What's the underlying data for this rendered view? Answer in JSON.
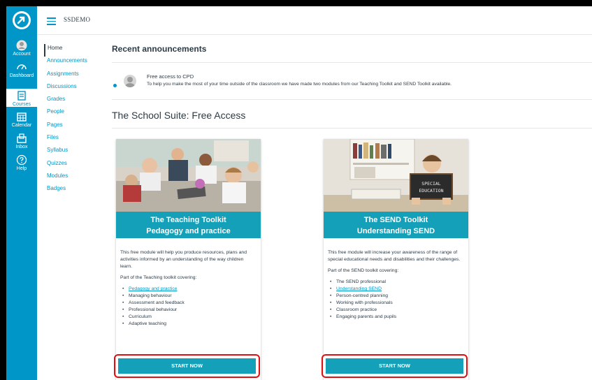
{
  "colors": {
    "brand": "#0096c7",
    "banner": "#14a0b8",
    "highlight": "#e01010"
  },
  "global_nav": {
    "items": [
      {
        "label": "Account",
        "icon": "account-icon"
      },
      {
        "label": "Dashboard",
        "icon": "dashboard-icon"
      },
      {
        "label": "Courses",
        "icon": "courses-icon"
      },
      {
        "label": "Calendar",
        "icon": "calendar-icon"
      },
      {
        "label": "Inbox",
        "icon": "inbox-icon"
      },
      {
        "label": "Help",
        "icon": "help-icon"
      }
    ]
  },
  "header": {
    "breadcrumb": "SSDEMO"
  },
  "course_nav": {
    "items": [
      "Home",
      "Announcements",
      "Assignments",
      "Discussions",
      "Grades",
      "People",
      "Pages",
      "Files",
      "Syllabus",
      "Quizzes",
      "Modules",
      "Badges"
    ]
  },
  "recent": {
    "heading": "Recent announcements",
    "items": [
      {
        "title": "Free access to CPD",
        "message": "To help you make the most of your time outside of the classroom we have made two modules from our Teaching Toolkit and SEND Toolkit available."
      }
    ]
  },
  "suite": {
    "title": "The School Suite: Free Access"
  },
  "cards": [
    {
      "line1": "The Teaching Toolkit",
      "line2": "Pedagogy and practice",
      "description": "This free module will help you produce resources, plans and activities informed by an understanding of the way children learn.",
      "covering": "Part of the Teaching toolkit covering:",
      "items": [
        "Pedagogy and practice",
        "Managing behaviour",
        "Assessment and feedback",
        "Professional behaviour",
        "Curriculum",
        "Adaptive teaching"
      ],
      "button": "START NOW"
    },
    {
      "line1": "The SEND Toolkit",
      "line2": "Understanding SEND",
      "chalkboard": "SPECIAL EDUCATION",
      "description": "This free module will increase your awareness of the range of special educational needs and disabilities and their challenges.",
      "covering": "Part of the SEND toolkit covering:",
      "items": [
        "The SEND professional",
        "Understanding SEND",
        "Person-centred planning",
        "Working with professionals",
        "Classroom practice",
        "Engaging parents and pupils"
      ],
      "button": "START NOW"
    }
  ]
}
